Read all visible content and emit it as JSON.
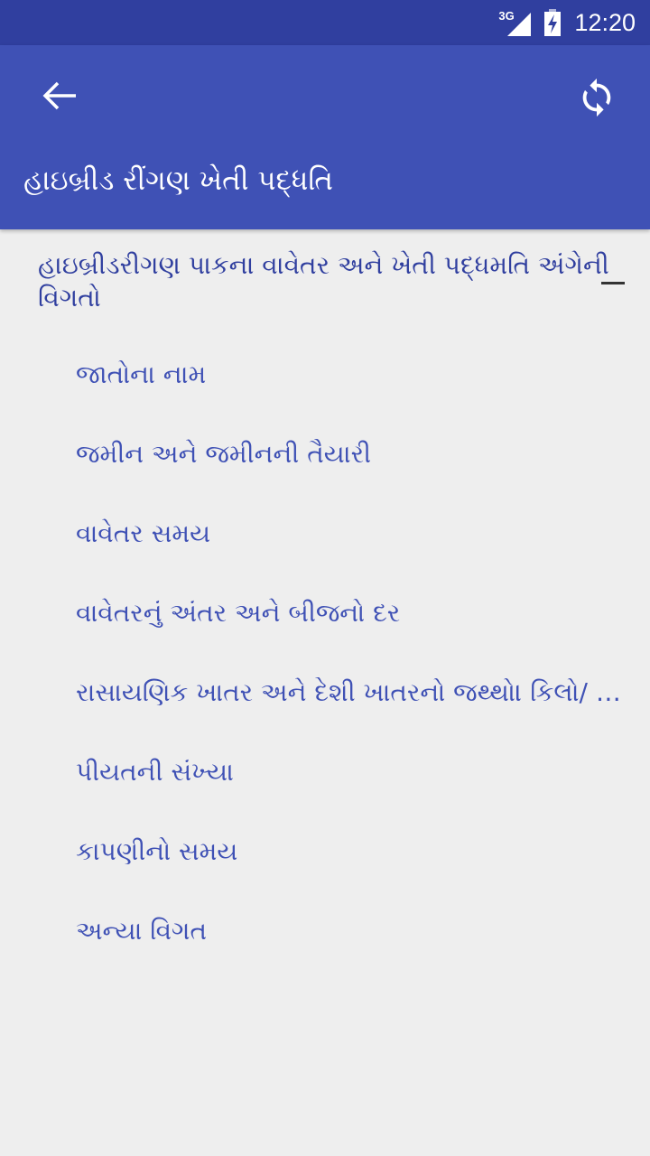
{
  "status_bar": {
    "network": "3G",
    "time": "12:20"
  },
  "app_bar": {
    "title": "હાઇબ્રીડ રીંગણ ખેતી પદ્ધતિ"
  },
  "content": {
    "heading": "હાઇબ્રીડરીગણ પાકના વાવેતર અને ખેતી પદ્ધમતિ અંગેની વિગતો",
    "items": [
      "જાતોના નામ",
      "જમીન અને જમીનની તૈયારી",
      "વાવેતર સમય",
      "વાવેતરનું અંતર અને બીજનો દર",
      "રાસાયણિક ખાતર અને દેશી ખાતરનો જથ્થો। કિલો/ હે...",
      "પીયતની સંખ્યા",
      "કાપણીનો સમય",
      "અન્યા વિગત"
    ]
  },
  "colors": {
    "status_bar": "#303f9f",
    "app_bar": "#3f51b5",
    "background": "#eeeeee",
    "text": "#3f51b5"
  },
  "icons": {
    "back": "arrow-back-icon",
    "refresh": "refresh-icon",
    "signal": "signal-icon",
    "battery": "battery-charging-icon"
  }
}
